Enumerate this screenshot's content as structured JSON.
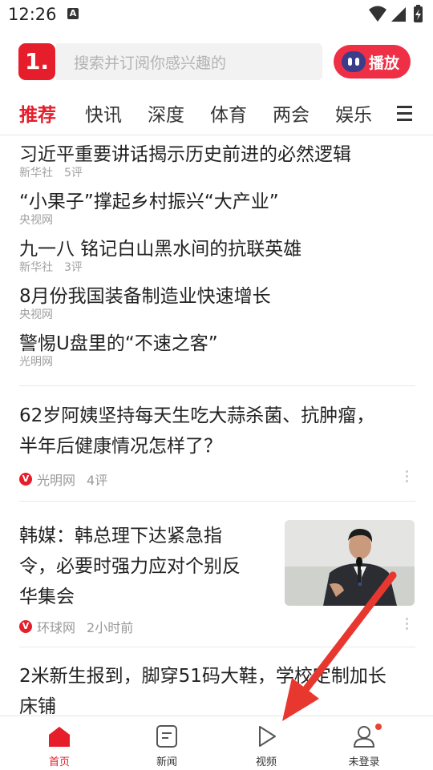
{
  "status_bar": {
    "time": "12:26",
    "notif_icon": "A"
  },
  "top_bar": {
    "logo_text": "1.",
    "search_placeholder": "搜索并订阅你感兴趣的",
    "play_label": "播放"
  },
  "tabs": [
    {
      "label": "推荐",
      "active": true
    },
    {
      "label": "快讯"
    },
    {
      "label": "深度"
    },
    {
      "label": "体育"
    },
    {
      "label": "两会"
    },
    {
      "label": "娱乐"
    }
  ],
  "headlines": [
    {
      "title": "习近平重要讲话揭示历史前进的必然逻辑",
      "source": "新华社",
      "comments": "5评"
    },
    {
      "title": "“小果子”撑起乡村振兴“大产业”",
      "source": "央视网",
      "comments": ""
    },
    {
      "title": "九一八 铭记白山黑水间的抗联英雄",
      "source": "新华社",
      "comments": "3评"
    },
    {
      "title": "8月份我国装备制造业快速增长",
      "source": "央视网",
      "comments": ""
    },
    {
      "title": "警惕U盘里的“不速之客”",
      "source": "光明网",
      "comments": ""
    }
  ],
  "articles": [
    {
      "title_lines": [
        "62岁阿姨坚持每天生吃大蒜杀菌、抗肿瘤，",
        "半年后健康情况怎样了？"
      ],
      "source_badge": "V",
      "source": "光明网",
      "meta": "4评"
    },
    {
      "title_lines": [
        "韩媒：韩总理下达紧急指",
        "令，必要时强力应对个别反",
        "华集会"
      ],
      "source_badge": "V",
      "source": "环球网",
      "meta": "2小时前"
    },
    {
      "title_lines": [
        "2米新生报到，脚穿51码大鞋，学校定制加长",
        "床铺"
      ]
    }
  ],
  "bottom_nav": [
    {
      "label": "首页",
      "icon": "home-icon",
      "active": true
    },
    {
      "label": "新闻",
      "icon": "news-icon"
    },
    {
      "label": "视频",
      "icon": "video-icon"
    },
    {
      "label": "未登录",
      "icon": "user-icon"
    }
  ],
  "colors": {
    "accent": "#e61e2b",
    "annotation_arrow": "#e8372f"
  }
}
